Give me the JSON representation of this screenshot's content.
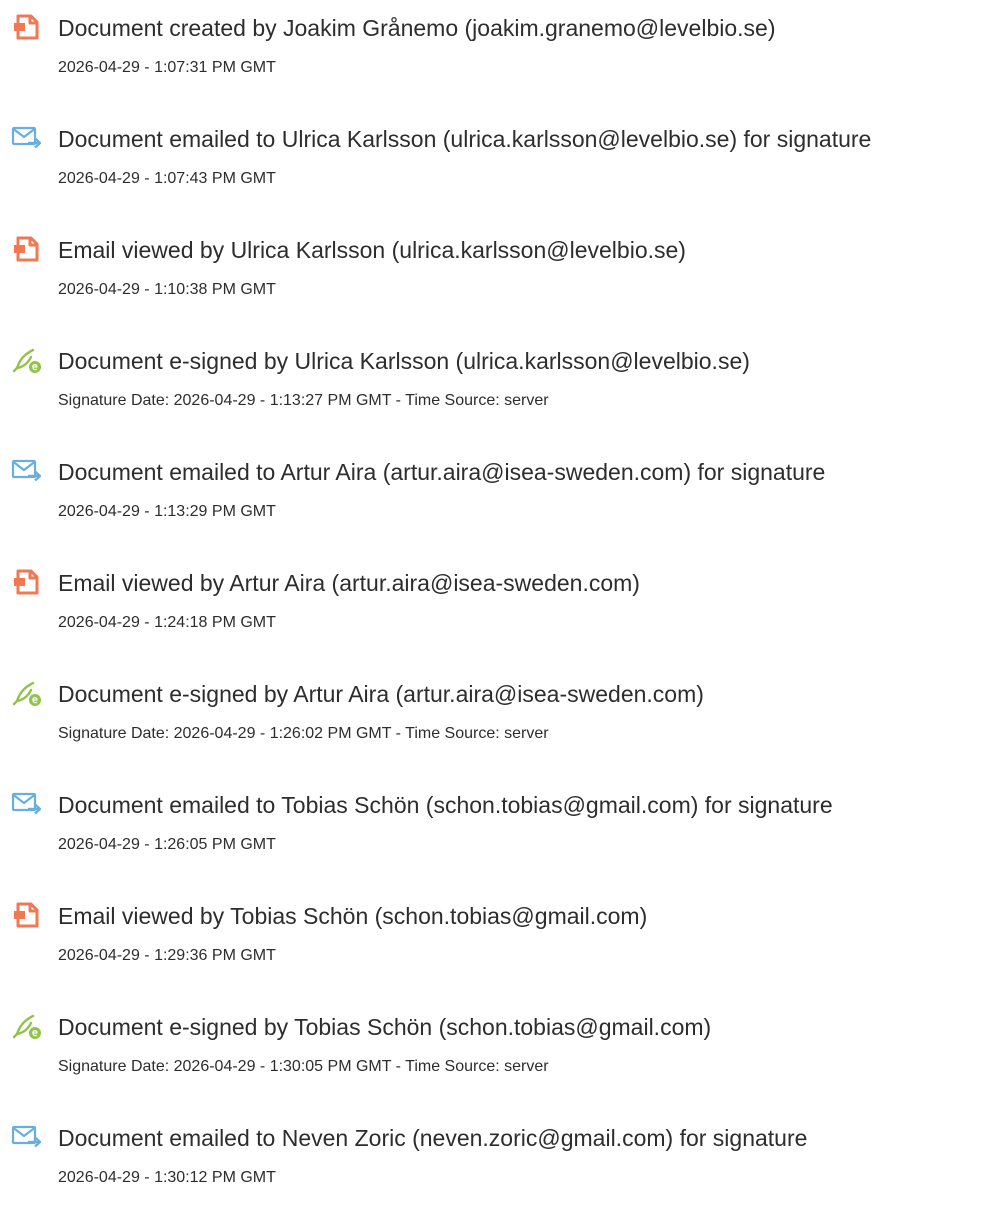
{
  "colors": {
    "created_icon": "#f07852",
    "email_icon": "#68aede",
    "sign_icon": "#8fc34a",
    "text": "#2d2d2d"
  },
  "entries": [
    {
      "icon": "document-icon",
      "title": "Document created by Joakim Grånemo (joakim.granemo@levelbio.se)",
      "detail": "2026-04-29 - 1:07:31 PM GMT"
    },
    {
      "icon": "email-sent-icon",
      "title": "Document emailed to Ulrica Karlsson (ulrica.karlsson@levelbio.se) for signature",
      "detail": "2026-04-29 - 1:07:43 PM GMT"
    },
    {
      "icon": "document-icon",
      "title": "Email viewed by Ulrica Karlsson (ulrica.karlsson@levelbio.se)",
      "detail": "2026-04-29 - 1:10:38 PM GMT"
    },
    {
      "icon": "e-sign-icon",
      "title": "Document e-signed by Ulrica Karlsson (ulrica.karlsson@levelbio.se)",
      "detail": "Signature Date: 2026-04-29 - 1:13:27 PM GMT - Time Source: server"
    },
    {
      "icon": "email-sent-icon",
      "title": "Document emailed to Artur Aira (artur.aira@isea-sweden.com) for signature",
      "detail": "2026-04-29 - 1:13:29 PM GMT"
    },
    {
      "icon": "document-icon",
      "title": "Email viewed by Artur Aira (artur.aira@isea-sweden.com)",
      "detail": "2026-04-29 - 1:24:18 PM GMT"
    },
    {
      "icon": "e-sign-icon",
      "title": "Document e-signed by Artur Aira (artur.aira@isea-sweden.com)",
      "detail": "Signature Date: 2026-04-29 - 1:26:02 PM GMT - Time Source: server"
    },
    {
      "icon": "email-sent-icon",
      "title": "Document emailed to Tobias Schön (schon.tobias@gmail.com) for signature",
      "detail": "2026-04-29 - 1:26:05 PM GMT"
    },
    {
      "icon": "document-icon",
      "title": "Email viewed by Tobias Schön (schon.tobias@gmail.com)",
      "detail": "2026-04-29 - 1:29:36 PM GMT"
    },
    {
      "icon": "e-sign-icon",
      "title": "Document e-signed by Tobias Schön (schon.tobias@gmail.com)",
      "detail": "Signature Date: 2026-04-29 - 1:30:05 PM GMT - Time Source: server"
    },
    {
      "icon": "email-sent-icon",
      "title": "Document emailed to Neven Zoric (neven.zoric@gmail.com) for signature",
      "detail": "2026-04-29 - 1:30:12 PM GMT"
    }
  ]
}
